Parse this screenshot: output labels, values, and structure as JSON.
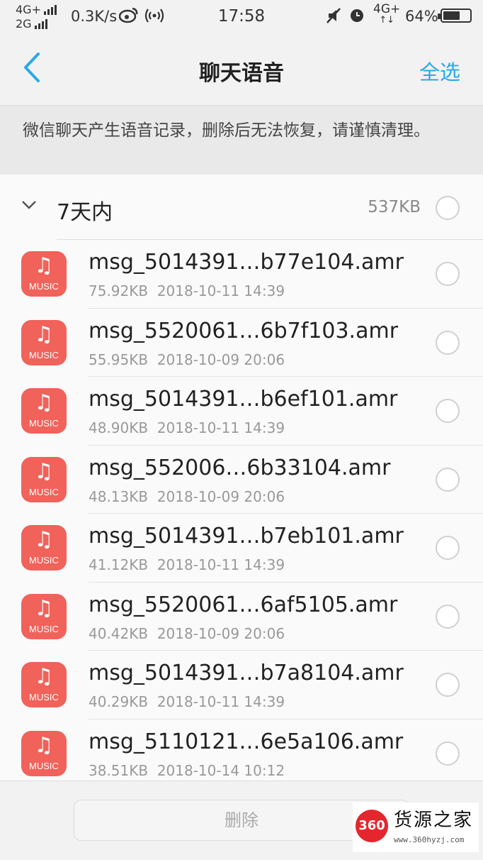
{
  "status_bar": {
    "network_1": "4G+",
    "network_2": "2G",
    "speed": "0.3K/s",
    "time": "17:58",
    "network_3": "4G+",
    "battery_percent": "64%",
    "battery_level": 0.64,
    "icons": [
      "signal-icon",
      "weibo-icon",
      "hotspot-icon",
      "mute-icon",
      "alarm-icon",
      "battery-icon"
    ]
  },
  "header": {
    "title": "聊天语音",
    "select_all": "全选",
    "back_icon": "chevron-left-icon",
    "accent": "#2ba8e6"
  },
  "notice": "微信聊天产生语音记录，删除后无法恢复，请谨慎清理。",
  "group": {
    "title": "7天内",
    "size": "537KB"
  },
  "music_label": "MUSIC",
  "files": [
    {
      "name": "msg_5014391…b77e104.amr",
      "size": "75.92KB",
      "date": "2018-10-11 14:39"
    },
    {
      "name": "msg_5520061…6b7f103.amr",
      "size": "55.95KB",
      "date": "2018-10-09 20:06"
    },
    {
      "name": "msg_5014391…b6ef101.amr",
      "size": "48.90KB",
      "date": "2018-10-11 14:39"
    },
    {
      "name": "msg_552006…6b33104.amr",
      "size": "48.13KB",
      "date": "2018-10-09 20:06"
    },
    {
      "name": "msg_5014391…b7eb101.amr",
      "size": "41.12KB",
      "date": "2018-10-11 14:39"
    },
    {
      "name": "msg_5520061…6af5105.amr",
      "size": "40.42KB",
      "date": "2018-10-09 20:06"
    },
    {
      "name": "msg_5014391…b7a8104.amr",
      "size": "40.29KB",
      "date": "2018-10-11 14:39"
    },
    {
      "name": "msg_5110121…6e5a106.amr",
      "size": "38.51KB",
      "date": "2018-10-14 10:12"
    }
  ],
  "bottom": {
    "delete_label": "删除"
  },
  "watermark": {
    "badge": "360",
    "name": "货源之家",
    "url": "www.360hyzj.com"
  },
  "colors": {
    "music_icon_bg": "#f0625a",
    "radio_border": "#d0d0d0"
  }
}
